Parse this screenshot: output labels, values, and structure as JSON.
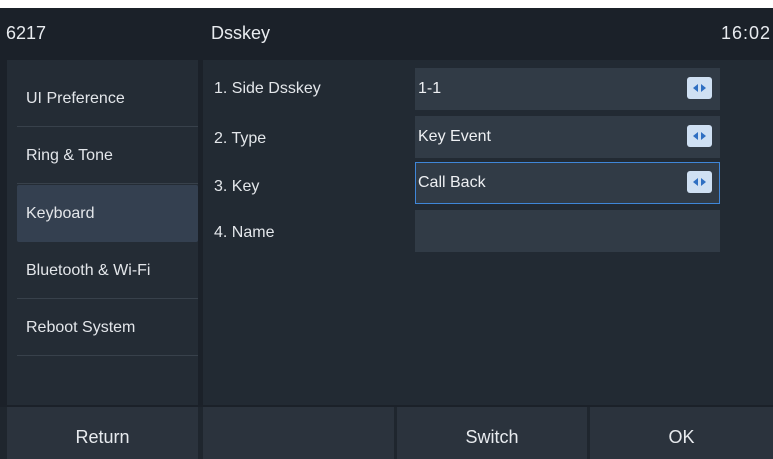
{
  "statusbar": {
    "extension": "6217",
    "title": "Dsskey",
    "time": "16:02"
  },
  "menu": {
    "items": [
      {
        "label": "UI Preference"
      },
      {
        "label": "Ring & Tone"
      },
      {
        "label": "Keyboard",
        "selected": true
      },
      {
        "label": "Bluetooth & Wi-Fi"
      },
      {
        "label": "Reboot System"
      }
    ]
  },
  "form": {
    "rows": [
      {
        "label": "1. Side Dsskey",
        "value": "1-1",
        "has_arrows": true
      },
      {
        "label": "2. Type",
        "value": "Key Event",
        "has_arrows": true
      },
      {
        "label": "3. Key",
        "value": "Call Back",
        "has_arrows": true,
        "focused": true
      },
      {
        "label": "4. Name",
        "value": "",
        "has_arrows": false
      }
    ]
  },
  "softkeys": [
    {
      "label": "Return"
    },
    {
      "label": ""
    },
    {
      "label": "Switch"
    },
    {
      "label": "OK"
    }
  ],
  "icons": {
    "arrow_toggle": "left-right-arrows-icon"
  },
  "colors": {
    "background": "#1b2129",
    "panel": "#222a33",
    "field": "#313b46",
    "selected_menu": "#344050",
    "focus_border": "#3f86d8",
    "arrow_button": "#cfe0f3",
    "arrow_glyph": "#2f6fc2"
  }
}
